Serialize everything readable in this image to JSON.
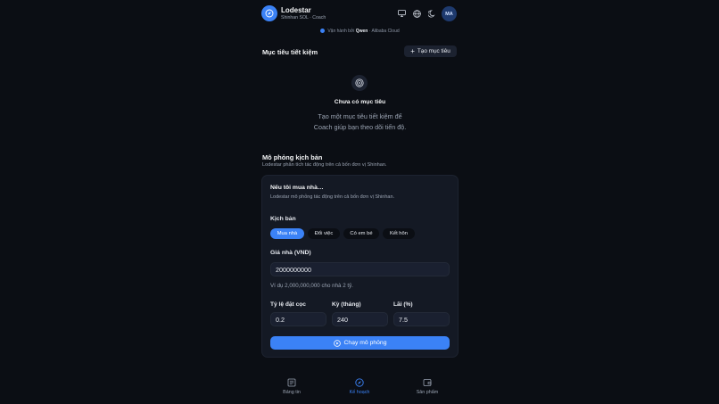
{
  "app": {
    "title": "Lodestar",
    "subtitle": "Shinhan SOL · Coach",
    "avatar_initials": "MA",
    "brand_color": "#3b82f6"
  },
  "header_icons": [
    "monitor-icon",
    "globe-icon",
    "moon-icon"
  ],
  "powered": {
    "prefix": "Vận hành bởi",
    "model": "Qwen",
    "suffix": "· Alibaba Cloud"
  },
  "goals": {
    "title": "Mục tiêu tiết kiệm",
    "add_button": "Tạo mục tiêu",
    "empty_title": "Chưa có mục tiêu",
    "empty_line1": "Tạo một mục tiêu tiết kiệm để",
    "empty_line2": "Coach giúp bạn theo dõi tiến độ."
  },
  "simulation": {
    "title": "Mô phỏng kịch bản",
    "subtitle": "Lodestar phân tích tác động trên cả bốn đơn vị Shinhan.",
    "card_title": "Nếu tôi mua nhà…",
    "card_subtitle": "Lodestar mô phỏng tác động trên cả bốn đơn vị Shinhan.",
    "scenario_label": "Kịch bản",
    "scenarios": [
      "Mua nhà",
      "Đổi việc",
      "Có em bé",
      "Kết hôn"
    ],
    "active_scenario": "Mua nhà",
    "price_label": "Giá nhà (VND)",
    "price_value": "2000000000",
    "price_hint": "Ví dụ 2,000,000,000 cho nhà 2 tỷ.",
    "down_label": "Tỷ lệ đặt cọc",
    "down_value": "0.2",
    "term_label": "Kỳ (tháng)",
    "term_value": "240",
    "rate_label": "Lãi (%)",
    "rate_value": "7.5",
    "run_button": "Chạy mô phỏng"
  },
  "nav": {
    "items": [
      "Bảng tin",
      "Kế hoạch",
      "Sản phẩm"
    ],
    "active": "Kế hoạch"
  }
}
